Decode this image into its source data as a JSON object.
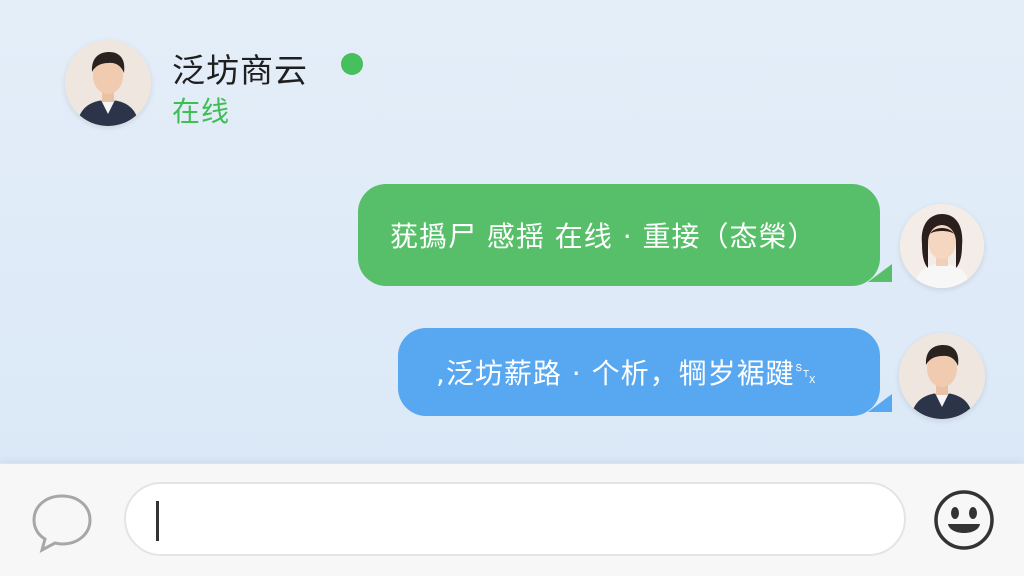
{
  "header": {
    "contact_name": "泛坊商云",
    "status": "在线"
  },
  "messages": [
    {
      "text": "莸撝尸 感揺 在线 · 重接（态榮）",
      "color": "#57bf69"
    },
    {
      "text": ",泛坊薪路 · 个析，犅岁裾踺␂",
      "color": "#58a7f1"
    }
  ],
  "input": {
    "value": "",
    "placeholder": ""
  },
  "icons": {
    "chat": "speech-bubble-icon",
    "emoji": "smiley-face-icon",
    "online": "online-indicator-icon"
  },
  "colors": {
    "accent_green": "#46c05c",
    "bubble_green": "#57bf69",
    "bubble_blue": "#58a7f1",
    "status_text": "#3fbe55"
  }
}
